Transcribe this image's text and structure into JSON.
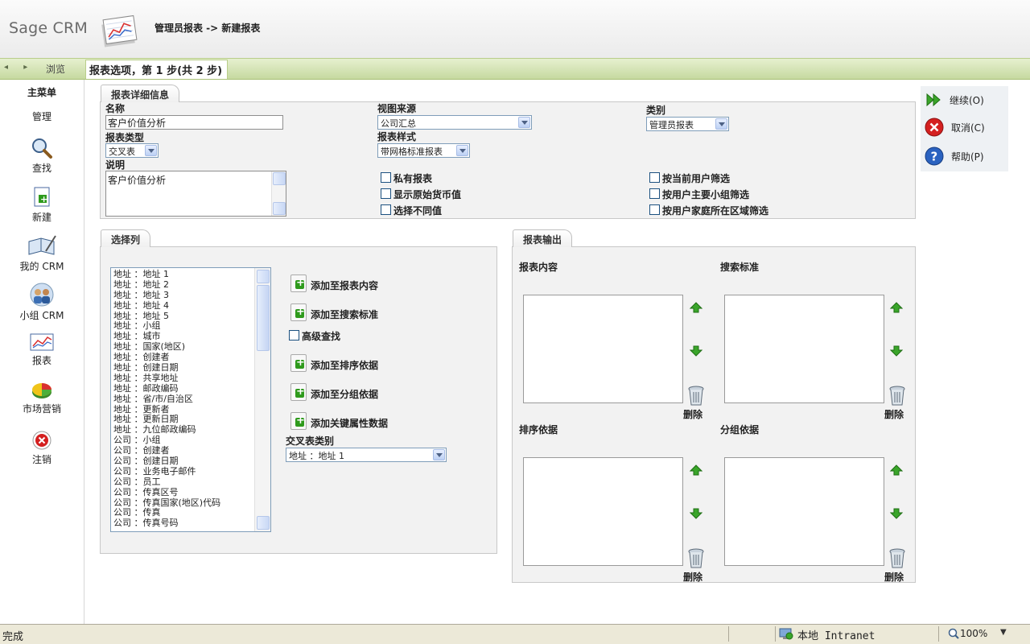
{
  "app": {
    "logo": "Sage CRM"
  },
  "header": {
    "breadcrumb": "管理员报表  -> 新建报表"
  },
  "nav": {
    "back_forward": "◂ ▸",
    "browse_label": "浏览"
  },
  "steps": {
    "label": "报表选项，第 1 步(共 2 步)"
  },
  "sidebar": {
    "title": "主菜单",
    "admin": "管理",
    "items": [
      {
        "label": "查找",
        "icon": "magnifier-icon"
      },
      {
        "label": "新建",
        "icon": "new-document-icon"
      },
      {
        "label": "我的 CRM",
        "icon": "my-crm-icon"
      },
      {
        "label": "小组 CRM",
        "icon": "team-crm-icon"
      },
      {
        "label": "报表",
        "icon": "report-chart-icon"
      },
      {
        "label": "市场营销",
        "icon": "pie-chart-icon"
      },
      {
        "label": "注销",
        "icon": "logout-icon"
      }
    ]
  },
  "details": {
    "tab": "报表详细信息",
    "name_label": "名称",
    "name_value": "客户价值分析",
    "type_label": "报表类型",
    "type_value": "交叉表",
    "desc_label": "说明",
    "desc_value": "客户价值分析",
    "view_label": "视图来源",
    "view_value": "公司汇总",
    "style_label": "报表样式",
    "style_value": "带网格标准报表",
    "category_label": "类别",
    "category_value": "管理员报表",
    "checks": {
      "private": "私有报表",
      "original_currency": "显示原始货币值",
      "distinct": "选择不同值",
      "current_user": "按当前用户筛选",
      "user_team": "按用户主要小组筛选",
      "user_region": "按用户家庭所在区域筛选"
    }
  },
  "columns": {
    "tab": "选择列",
    "items": [
      "地址 ：地址 1",
      "地址 ：地址 2",
      "地址 ：地址 3",
      "地址 ：地址 4",
      "地址 ：地址 5",
      "地址 ：小组",
      "地址 ：城市",
      "地址 ：国家(地区)",
      "地址 ：创建者",
      "地址 ：创建日期",
      "地址 ：共享地址",
      "地址 ：邮政编码",
      "地址 ：省/市/自治区",
      "地址 ：更新者",
      "地址 ：更新日期",
      "地址 ：九位邮政编码",
      "公司 ：小组",
      "公司 ：创建者",
      "公司 ：创建日期",
      "公司 ：业务电子邮件",
      "公司 ：员工",
      "公司 ：传真区号",
      "公司 ：传真国家(地区)代码",
      "公司 ：传真",
      "公司 ：传真号码"
    ],
    "add_content": "添加至报表内容",
    "add_search": "添加至搜索标准",
    "advanced_search": "高级查找",
    "add_sort": "添加至排序依据",
    "add_group": "添加至分组依据",
    "add_key_attr": "添加关键属性数据",
    "crosstab_label": "交叉表类别",
    "crosstab_value": "地址 ：地址 1"
  },
  "output": {
    "tab": "报表输出",
    "content_label": "报表内容",
    "search_label": "搜索标准",
    "sort_label": "排序依据",
    "group_label": "分组依据",
    "delete_label": "删除"
  },
  "actions": {
    "continue": "继续(O)",
    "cancel": "取消(C)",
    "help": "帮助(P)"
  },
  "statusbar": {
    "status": "完成",
    "zone": "本地 Intranet",
    "zoom": "100%"
  },
  "colors": {
    "green_bar": "#c6d9a0",
    "panel_bg": "#f2f2f2",
    "arrow_green": "#3aa52a",
    "cancel_red": "#d42020",
    "help_blue": "#2a62c0"
  }
}
